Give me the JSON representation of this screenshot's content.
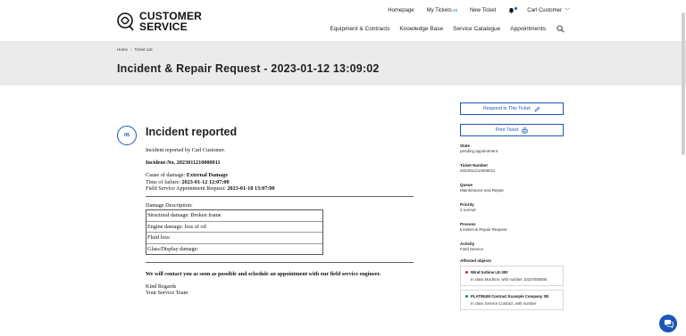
{
  "brand": {
    "line1": "CUSTOMER",
    "line2": "SERVICE"
  },
  "topnav": {
    "homepage": "Homepage",
    "my_tickets": "My Tickets",
    "my_tickets_count": "23",
    "new_ticket": "New Ticket",
    "user": "Carl Customer"
  },
  "mainnav": [
    "Equipment & Contracts",
    "Knowledge Base",
    "Service Catalogue",
    "Appointments"
  ],
  "breadcrumb": {
    "home": "Home",
    "current": "Ticket List"
  },
  "page_title": "Incident & Repair Request - 2023-01-12 13:09:02",
  "step": {
    "number": "05",
    "title": "Incident reported"
  },
  "document": {
    "reported_by": "Incident reported by Carl Customer.",
    "incident_no_label": "Incident-No. 2023011210000011",
    "cause_label": "Cause of damage:",
    "cause_value": "External Damage",
    "failure_label": "Time of failure:",
    "failure_value": "2023-01-12 12:07:00",
    "appt_label": "Field Service Appointment Request:",
    "appt_value": "2023-01-18 13:07:00",
    "damage_heading": "Damage Description:",
    "damage_rows": [
      "Structural damage:  Broken frame",
      "Engine damage: loss of oil",
      "Fluid loss:",
      "Glass/Display damage:"
    ],
    "contact_line": "We will contact you as soon as possible and schedule an appointment with our field service engineer.",
    "regards": "Kind Regards",
    "team": "Your Service Team"
  },
  "sidebar": {
    "respond_label": "Respond to This Ticket",
    "print_label": "Print Ticket",
    "props": [
      {
        "key": "State",
        "value": "pending appointment"
      },
      {
        "key": "Ticket Number",
        "value": "2023011210000011"
      },
      {
        "key": "Queue",
        "value": "Maintenance and Repair"
      },
      {
        "key": "Priority",
        "value": "3 normal"
      },
      {
        "key": "Process",
        "value": "Incident & Repair Request"
      },
      {
        "key": "Activity",
        "value": "Field Service"
      }
    ],
    "affected_title": "Affected objects",
    "affected": [
      {
        "name": "Wind turbine LE-300",
        "sub": "In class Machine, with number 10107080006",
        "color": "#c62828"
      },
      {
        "name": "PLATINUM Contract Example Company SE",
        "sub": "In class Service Contract, with number",
        "color": "#0d8a8a"
      }
    ]
  },
  "colors": {
    "accent": "#1a57b6",
    "banner": "#ebebeb"
  }
}
